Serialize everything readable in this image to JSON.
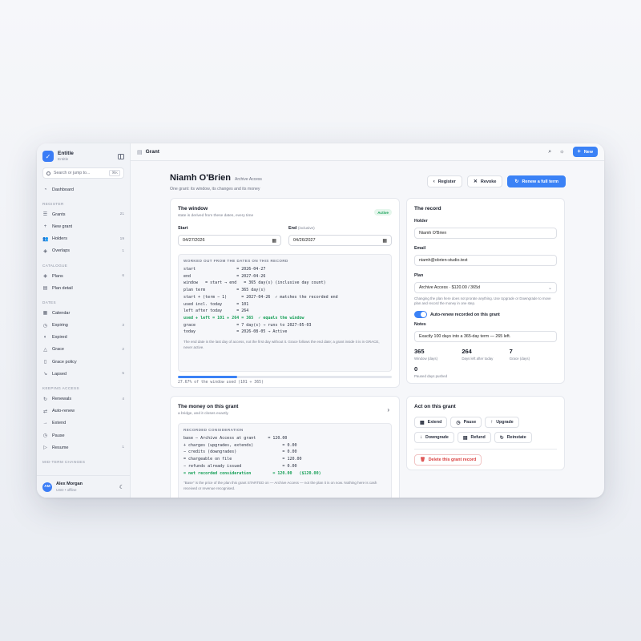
{
  "brand": {
    "name": "Entitle",
    "sub": "Entitle"
  },
  "search": {
    "placeholder": "Search or jump to...",
    "shortcut": "⌘K"
  },
  "sidebar": {
    "top": [
      {
        "label": "Dashboard",
        "icon": "dashboard-icon",
        "glyph": "◔"
      }
    ],
    "sections": [
      {
        "title": "REGISTER",
        "items": [
          {
            "label": "Grants",
            "count": "21",
            "glyph": "☰",
            "icon": "list-icon"
          },
          {
            "label": "New grant",
            "count": "",
            "glyph": "+",
            "icon": "plus-icon"
          },
          {
            "label": "Holders",
            "count": "19",
            "glyph": "👥",
            "icon": "users-icon"
          },
          {
            "label": "Overlaps",
            "count": "1",
            "glyph": "◈",
            "icon": "layers-icon"
          }
        ]
      },
      {
        "title": "CATALOGUE",
        "items": [
          {
            "label": "Plans",
            "count": "6",
            "glyph": "◈",
            "icon": "layers-icon"
          },
          {
            "label": "Plan detail",
            "count": "",
            "glyph": "▤",
            "icon": "document-icon"
          }
        ]
      },
      {
        "title": "DATES",
        "items": [
          {
            "label": "Calendar",
            "count": "",
            "glyph": "▦",
            "icon": "calendar-icon"
          },
          {
            "label": "Expiring",
            "count": "3",
            "glyph": "◷",
            "icon": "clock-icon"
          },
          {
            "label": "Expired",
            "count": "",
            "glyph": "◐",
            "icon": "moon-icon"
          },
          {
            "label": "Grace",
            "count": "2",
            "glyph": "△",
            "icon": "warning-icon"
          },
          {
            "label": "Grace policy",
            "count": "",
            "glyph": "▯",
            "icon": "book-icon"
          },
          {
            "label": "Lapsed",
            "count": "5",
            "glyph": "↘",
            "icon": "trend-down-icon"
          }
        ]
      },
      {
        "title": "KEEPING ACCESS",
        "items": [
          {
            "label": "Renewals",
            "count": "4",
            "glyph": "↻",
            "icon": "refresh-icon"
          },
          {
            "label": "Auto-renew",
            "count": "",
            "glyph": "⇄",
            "icon": "repeat-icon"
          },
          {
            "label": "Extend",
            "count": "",
            "glyph": "→",
            "icon": "arrow-right-icon"
          },
          {
            "label": "Pause",
            "count": "",
            "glyph": "◷",
            "icon": "clock-icon"
          },
          {
            "label": "Resume",
            "count": "1",
            "glyph": "▷",
            "icon": "play-icon"
          }
        ]
      },
      {
        "title": "MID-TERM CHANGES",
        "items": []
      }
    ]
  },
  "user": {
    "initials": "AM",
    "name": "Alex Morgan",
    "sub": "USD • offline"
  },
  "topbar": {
    "title": "Grant",
    "new_label": "New"
  },
  "header": {
    "name": "Niamh O'Brien",
    "plan_tag": "Archive Access",
    "subtitle": "One grant: its window, its changes and its money",
    "register_label": "Register",
    "revoke_label": "Revoke",
    "renew_label": "Renew a full term"
  },
  "window_card": {
    "title": "The window",
    "sub": "state is derived from these dates, every time",
    "badge": "Active",
    "start_label": "Start",
    "end_label": "End",
    "end_qualifier": "(inclusive)",
    "start_value": "04/27/2026",
    "end_value": "04/26/2027",
    "worked_header": "WORKED OUT FROM THE DATES ON THIS RECORD",
    "lines": [
      "start                 = 2026-04-27",
      "end                   = 2027-04-26",
      "window   = start → end   = 365 day(s) (inclusive day count)",
      "plan term             = 365 day(s)",
      "start + (term − 1)      = 2027-04-26  ✓ matches the recorded end",
      "used incl. today      = 101",
      "left after today      = 264"
    ],
    "green_line": "used + left = 101 + 264 = 365  ✓ equals the window",
    "lines_after": [
      "grace                 = 7 day(s) → runs to 2027-05-03",
      "today                 = 2026-08-05 → Active"
    ],
    "note": "The end date is the last day of access, not the first day without it. Grace follows the end date; a grant inside it is in GRACE, never active.",
    "progress_fraction": 0.2767,
    "progress_text": "27.67% of the window used (101 ÷ 365)"
  },
  "money_card": {
    "title": "The money on this grant",
    "sub": "a bridge, and it closes exactly",
    "box_header": "RECORDED CONSIDERATION",
    "lines": [
      "base — Archive Access at grant     = 120.00",
      "+ charges (upgrades, extends)            = 0.00",
      "− credits (downgrades)                   = 0.00",
      "= chargeable on file                     = 120.00",
      "− refunds already issued                 = 0.00"
    ],
    "green_line": "= net recorded consideration         = 120.00   ($120.00)",
    "note": "\"Base\" is the price of the plan this grant STARTED on — Archive Access — not the plan it is on now. Nothing here is cash received or revenue recognised."
  },
  "record_card": {
    "title": "The record",
    "holder_label": "Holder",
    "holder_value": "Niamh O'Brien",
    "email_label": "Email",
    "email_value": "niamh@obrien-studio.test",
    "plan_label": "Plan",
    "plan_value": "Archive Access · $120.00 / 365d",
    "plan_help": "Changing the plan here does not prorate anything. Use Upgrade or Downgrade to move plan and record the money in one step.",
    "autorenew_label": "Auto-renew recorded on this grant",
    "notes_label": "Notes",
    "notes_value": "Exactly 100 days into a 365-day term — 265 left.",
    "stats": [
      {
        "value": "365",
        "label": "Window (days)"
      },
      {
        "value": "264",
        "label": "Days left after today"
      },
      {
        "value": "7",
        "label": "Grace (days)"
      },
      {
        "value": "0",
        "label": "Paused days pushed"
      }
    ]
  },
  "act_card": {
    "title": "Act on this grant",
    "buttons": [
      {
        "label": "Extend",
        "glyph": "▦",
        "icon": "calendar-icon"
      },
      {
        "label": "Pause",
        "glyph": "◷",
        "icon": "clock-icon"
      },
      {
        "label": "Upgrade",
        "glyph": "↑",
        "icon": "arrow-up-icon"
      },
      {
        "label": "Downgrade",
        "glyph": "↓",
        "icon": "arrow-down-icon"
      },
      {
        "label": "Refund",
        "glyph": "▤",
        "icon": "receipt-icon"
      },
      {
        "label": "Reinstate",
        "glyph": "↻",
        "icon": "refresh-icon"
      }
    ],
    "delete_label": "Delete this grant record"
  }
}
